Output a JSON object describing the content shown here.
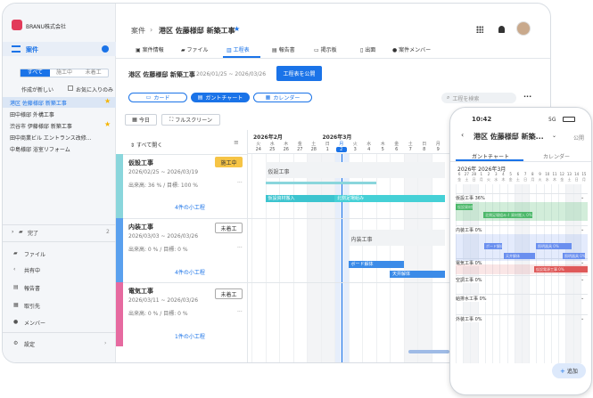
{
  "sidebar": {
    "logo": "BRANU株式会社",
    "section": "案件",
    "filters": [
      "すべて",
      "施工中",
      "未着工"
    ],
    "sort": "作成が新しい",
    "favorite_label": "お気に入りのみ",
    "projects": [
      "港区 佐藤様邸 新築工事",
      "田中様邸 外構工事",
      "渋谷市 伊藤様邸 新築工事",
      "田中商業ビル エントランス改修...",
      "中島様邸 浴室リフォーム"
    ],
    "done_label": "完了",
    "done_count": "2",
    "menu": [
      "ファイル",
      "共有中",
      "報告書",
      "取引先",
      "メンバー"
    ],
    "settings": "設定"
  },
  "header": {
    "breadcrumb_root": "案件",
    "title": "港区 佐藤様邸 新築工事",
    "tabs": [
      "案件情報",
      "ファイル",
      "工程表",
      "報告書",
      "掲示板",
      "出面",
      "案件メンバー"
    ]
  },
  "schedule": {
    "title": "港区 佐藤様邸 新築工事",
    "period": "2026/01/25 ~ 2026/03/26",
    "publish": "工程表を公開",
    "views": [
      "カード",
      "ガントチャート",
      "カレンダー"
    ],
    "search_placeholder": "工程を検索",
    "today": "今日",
    "fullscreen": "フルスクリーン",
    "open_all": "すべて開く"
  },
  "gantt": {
    "months": [
      "2026年2月",
      "2026年3月"
    ],
    "days": [
      "火",
      "水",
      "木",
      "金",
      "土",
      "日",
      "月",
      "火",
      "水",
      "木",
      "金",
      "土",
      "日",
      "月"
    ],
    "dates": [
      "24",
      "25",
      "26",
      "27",
      "28",
      "1",
      "2",
      "3",
      "4",
      "5",
      "6",
      "7",
      "8",
      "9"
    ],
    "groups": [
      {
        "name": "仮設工事",
        "period": "2026/02/25 ~ 2026/03/19",
        "progress": "出来高: 36 % / 目標: 100 %",
        "status": "施工中",
        "count": "4件の小工程",
        "bar_label": "仮設工事",
        "subs": [
          "仮設資材搬入",
          "北側足場組み"
        ]
      },
      {
        "name": "内装工事",
        "period": "2026/03/03 ~ 2026/03/26",
        "progress": "出来高: 0 % / 目標: 0 %",
        "status": "未着工",
        "count": "4件の小工程",
        "bar_label": "内装工事",
        "subs": [
          "ボード解体",
          "天井解体"
        ]
      },
      {
        "name": "電気工事",
        "period": "2026/03/11 ~ 2026/03/26",
        "progress": "出来高: 0 % / 目標: 0 %",
        "status": "未着工",
        "count": "1件の小工程"
      }
    ]
  },
  "phone": {
    "time": "10:42",
    "status": "5G",
    "title": "港区 佐藤様邸 新築...",
    "publish": "公開",
    "tabs": [
      "ガントチャート",
      "カレンダー"
    ],
    "months": "2026年 2026年3月",
    "days_top": [
      "6",
      "27",
      "28",
      "1",
      "2",
      "3",
      "4",
      "5",
      "6",
      "7",
      "8",
      "9",
      "10",
      "11",
      "12",
      "13",
      "14",
      "15"
    ],
    "days_bot": [
      "金",
      "土",
      "日",
      "月",
      "火",
      "水",
      "木",
      "金",
      "土",
      "日",
      "月",
      "火",
      "水",
      "木",
      "金",
      "土",
      "日",
      "月"
    ],
    "rows": [
      "仮設工事 36%",
      "内装工事 0%",
      "電気工事 0%",
      "空調工事 0%",
      "給排水工事 0%",
      "外装工事 0%"
    ],
    "bars": [
      "仮設資材搬",
      "北側足場組み 45%",
      "資材搬入 0%",
      "ボード解体",
      "天井解体",
      "照明器具 0%",
      "照明器具 0%",
      "仮設電源工事 0%"
    ],
    "add": "追加"
  }
}
